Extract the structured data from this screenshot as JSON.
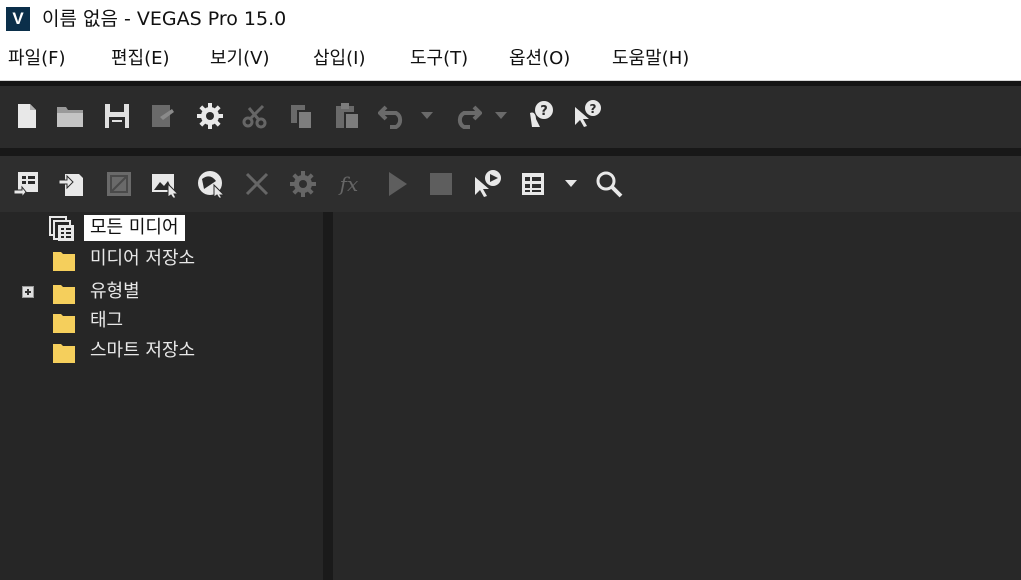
{
  "app": {
    "logo_letter": "V",
    "title": "이름 없음 - VEGAS Pro 15.0"
  },
  "menu": [
    "파일(F)",
    "편집(E)",
    "보기(V)",
    "삽입(I)",
    "도구(T)",
    "옵션(O)",
    "도움말(H)"
  ],
  "toolbar_main": {
    "icons": [
      "new-file-icon",
      "open-folder-icon",
      "save-icon",
      "render-as-icon",
      "properties-gear-icon",
      "cut-icon",
      "copy-icon",
      "paste-icon",
      "undo-icon",
      "undo-dropdown-icon",
      "redo-icon",
      "redo-dropdown-icon",
      "interactive-tutorial-icon",
      "whats-this-help-icon"
    ]
  },
  "toolbar_media": {
    "icons": [
      "import-media-icon",
      "capture-video-icon",
      "get-media-web-icon",
      "get-photos-icon",
      "media-generator-icon",
      "remove-icon",
      "media-properties-icon",
      "media-fx-icon",
      "play-icon",
      "stop-icon",
      "auto-preview-icon",
      "views-icon",
      "views-dropdown-icon",
      "search-media-icon"
    ]
  },
  "tree": {
    "items": [
      {
        "label": "모든 미디어",
        "selected": true
      },
      {
        "label": "미디어 저장소"
      },
      {
        "label": "유형별",
        "expandable": true
      },
      {
        "label": "태그"
      },
      {
        "label": "스마트 저장소"
      }
    ]
  },
  "colors": {
    "folder": "#f5cf5c",
    "panel_bg": "#262626",
    "toolbar_bg": "#2b2b2b"
  }
}
